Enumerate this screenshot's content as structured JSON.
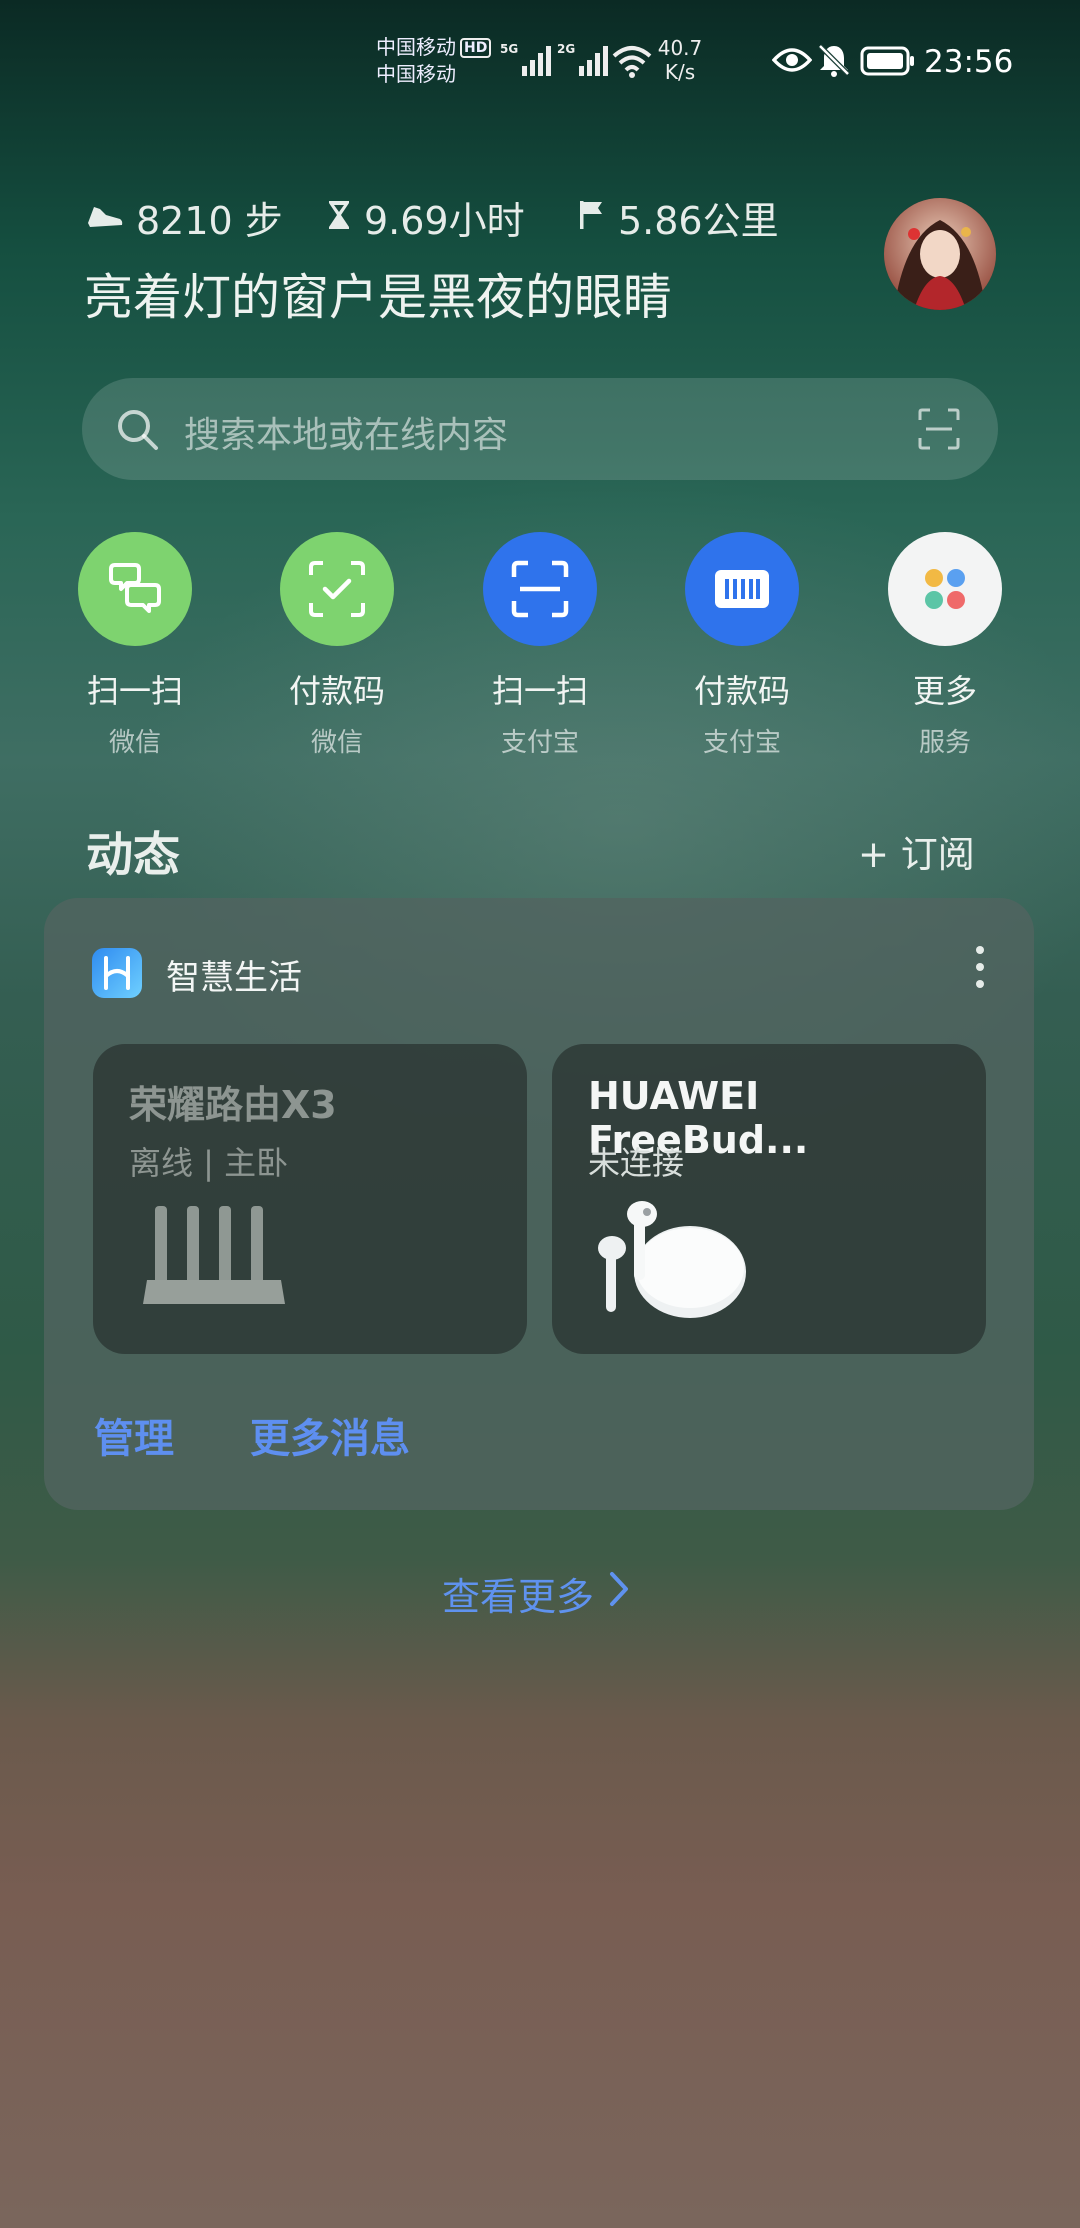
{
  "status_bar": {
    "carrier1": "中国移动",
    "hd_badge": "HD",
    "carrier2": "中国移动",
    "net1": "5G",
    "net2": "2G",
    "speed_value": "40.7",
    "speed_unit": "K/s",
    "time": "23:56"
  },
  "stats": {
    "steps": "8210 步",
    "duration": "9.69小时",
    "distance": "5.86公里"
  },
  "motto": "亮着灯的窗户是黑夜的眼睛",
  "search": {
    "placeholder": "搜索本地或在线内容"
  },
  "quick_actions": [
    {
      "title": "扫一扫",
      "sub": "微信",
      "color": "#7ed36f"
    },
    {
      "title": "付款码",
      "sub": "微信",
      "color": "#7ed36f"
    },
    {
      "title": "扫一扫",
      "sub": "支付宝",
      "color": "#2f73ec"
    },
    {
      "title": "付款码",
      "sub": "支付宝",
      "color": "#2f73ec"
    },
    {
      "title": "更多",
      "sub": "服务",
      "color": "#f3f4f4"
    }
  ],
  "feed": {
    "title": "动态",
    "subscribe": "+ 订阅"
  },
  "card": {
    "title": "智慧生活",
    "devices": [
      {
        "name": "荣耀路由X3",
        "status": "离线 | 主卧"
      },
      {
        "name": "HUAWEI FreeBud...",
        "status": "未连接"
      }
    ],
    "manage": "管理",
    "more_messages": "更多消息"
  },
  "see_more": "查看更多"
}
